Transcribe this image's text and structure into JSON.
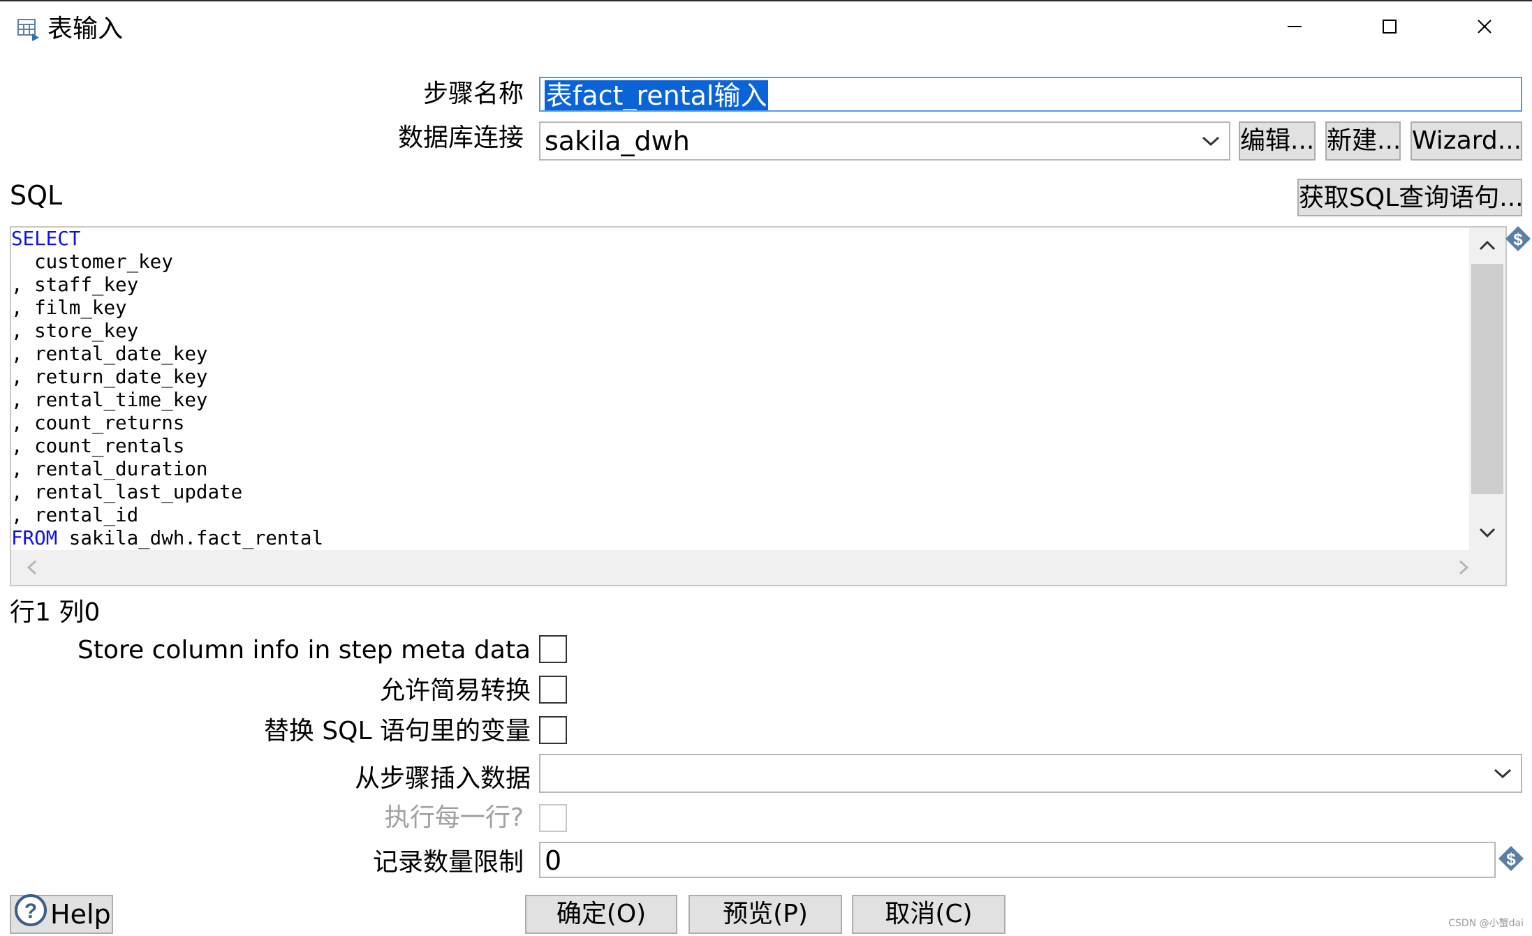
{
  "window": {
    "title": "表输入",
    "icon": "table-input-icon",
    "controls": [
      "minimize-icon",
      "maximize-icon",
      "close-icon"
    ]
  },
  "step_name": {
    "label": "步骤名称",
    "value": "表fact_rental输入"
  },
  "db_connection": {
    "label": "数据库连接",
    "value": "sakila_dwh",
    "edit_button": "编辑...",
    "new_button": "新建...",
    "wizard_button": "Wizard..."
  },
  "sql": {
    "label": "SQL",
    "get_query_button": "获取SQL查询语句...",
    "keyword_color": "#1010e6",
    "lines": [
      {
        "kw": "SELECT",
        "text": ""
      },
      {
        "kw": "",
        "text": "  customer_key"
      },
      {
        "kw": "",
        "text": ", staff_key"
      },
      {
        "kw": "",
        "text": ", film_key"
      },
      {
        "kw": "",
        "text": ", store_key"
      },
      {
        "kw": "",
        "text": ", rental_date_key"
      },
      {
        "kw": "",
        "text": ", return_date_key"
      },
      {
        "kw": "",
        "text": ", rental_time_key"
      },
      {
        "kw": "",
        "text": ", count_returns"
      },
      {
        "kw": "",
        "text": ", count_rentals"
      },
      {
        "kw": "",
        "text": ", rental_duration"
      },
      {
        "kw": "",
        "text": ", rental_last_update"
      },
      {
        "kw": "",
        "text": ", rental_id"
      },
      {
        "kw": "FROM",
        "text": " sakila_dwh.fact_rental"
      }
    ]
  },
  "cursor_status": "行1 列0",
  "options": {
    "store_column_info": {
      "label": "Store column info in step meta data",
      "checked": false
    },
    "lazy_conversion": {
      "label": "允许简易转换",
      "checked": false
    },
    "replace_variables": {
      "label": "替换 SQL 语句里的变量",
      "checked": false
    },
    "insert_from_step": {
      "label": "从步骤插入数据",
      "value": ""
    },
    "execute_each_row": {
      "label": "执行每一行?",
      "checked": false,
      "disabled": true
    },
    "limit": {
      "label": "记录数量限制",
      "value": "0"
    }
  },
  "footer": {
    "help_button": "Help",
    "ok_button": "确定(O)",
    "preview_button": "预览(P)",
    "cancel_button": "取消(C)"
  },
  "watermark": "CSDN @小蟹dai"
}
